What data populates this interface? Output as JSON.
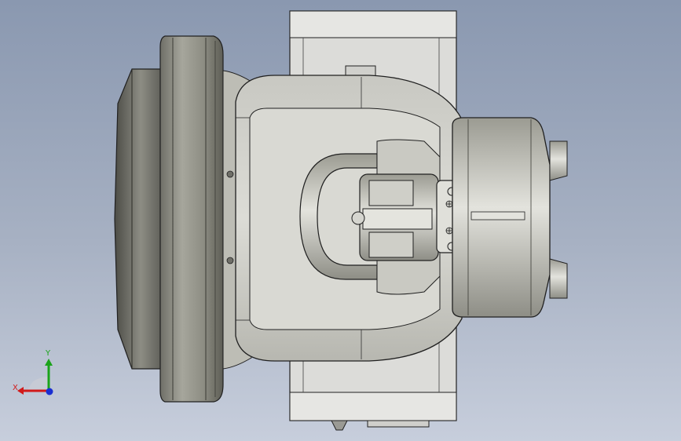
{
  "viewport": {
    "background_top": "#8a98b0",
    "background_bottom": "#c7cedc"
  },
  "model": {
    "body_color": "#d7d7d4",
    "edge_color": "#202020",
    "housing_color": "#dcdcd9"
  },
  "triad": {
    "x_label": "X",
    "y_label": "Y",
    "x_color": "#d11a1a",
    "y_color": "#1aa31a",
    "z_color": "#1a2fd1"
  }
}
